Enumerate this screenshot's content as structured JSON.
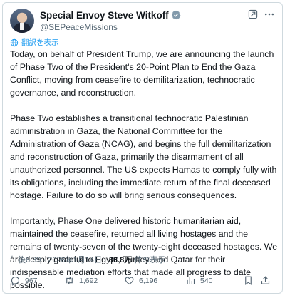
{
  "author": {
    "display_name": "Special Envoy Steve Witkoff",
    "handle": "@SEPeaceMissions",
    "verified_badge_icon": "government-verified-badge-icon",
    "badge_color": "#829aab"
  },
  "header_icons": {
    "grok": "grok-icon",
    "more": "more-horizontal-icon"
  },
  "translate": {
    "label": "翻訳を表示",
    "icon": "translate-globe-icon"
  },
  "tweet": {
    "paragraphs": [
      "Today, on behalf of President Trump, we are announcing the launch of Phase Two of the President's 20-Point Plan to End the Gaza Conflict, moving from ceasefire to demilitarization, technocratic governance, and reconstruction.",
      "Phase Two establishes a transitional technocratic Palestinian administration in Gaza, the National Committee for the Administration of Gaza (NCAG), and begins the full demilitarization and reconstruction of Gaza, primarily the disarmament of all unauthorized personnel. The US expects Hamas to comply fully with its obligations, including the immediate return of the final deceased hostage. Failure to do so will bring serious consequences.",
      "Importantly, Phase One delivered historic humanitarian aid, maintained the ceasefire, returned all living hostages and the remains of twenty-seven of the twenty-eight deceased hostages. We are deeply grateful to Egypt, Turkey, and Qatar for their indispensable mediation efforts that made all progress to date possible."
    ]
  },
  "meta": {
    "time": "午後6:39",
    "separator": " · ",
    "date": "2026年1月14日",
    "views_count": "86.8万",
    "views_label": " 件の表示"
  },
  "actions": {
    "reply": {
      "icon": "reply-icon",
      "count": "967"
    },
    "retweet": {
      "icon": "retweet-icon",
      "count": "1,692"
    },
    "like": {
      "icon": "heart-icon",
      "count": "6,196"
    },
    "views": {
      "icon": "views-chart-icon",
      "count": "540"
    },
    "bookmark": {
      "icon": "bookmark-icon"
    },
    "share": {
      "icon": "share-icon"
    }
  },
  "colors": {
    "text": "#0f1419",
    "secondary": "#536471",
    "link": "#1d9bf0",
    "border": "#cfd9de"
  }
}
